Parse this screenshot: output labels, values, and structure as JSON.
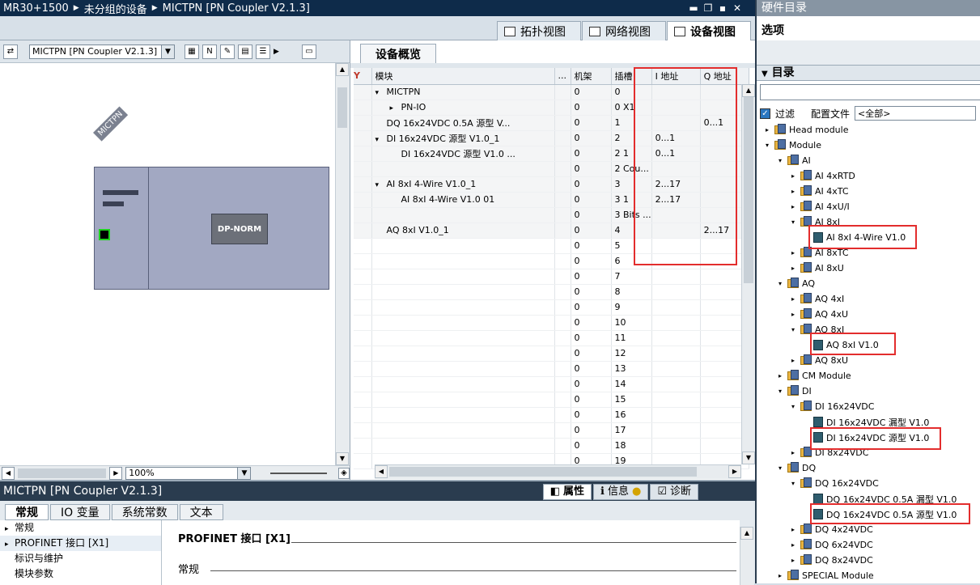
{
  "titlebar": {
    "crumb1": "MR30+1500",
    "crumb2": "未分组的设备",
    "crumb3": "MICTPN [PN Coupler V2.1.3]"
  },
  "view_tabs": {
    "topology": "拓扑视图",
    "network": "网络视图",
    "device": "设备视图"
  },
  "device_toolbar": {
    "device_select": "MICTPN [PN Coupler V2.1.3]",
    "zoom": "100%"
  },
  "canvas": {
    "device_label": "MICTPN",
    "module_label": "DP-NORM"
  },
  "overview": {
    "tab": "设备概览",
    "columns": {
      "module": "模块",
      "dots": "...",
      "rack": "机架",
      "slot": "插槽",
      "i_addr": "I 地址",
      "q_addr": "Q 地址"
    },
    "rows": [
      {
        "arrow": "▾",
        "indent": 0,
        "module": "MICTPN",
        "rack": "0",
        "slot": "0",
        "i": "",
        "q": ""
      },
      {
        "arrow": "▸",
        "indent": 1,
        "module": "PN-IO",
        "rack": "0",
        "slot": "0 X1",
        "i": "",
        "q": ""
      },
      {
        "arrow": "",
        "indent": 0,
        "module": "DQ 16x24VDC 0.5A 源型 V...",
        "rack": "0",
        "slot": "1",
        "i": "",
        "q": "0...1"
      },
      {
        "arrow": "▾",
        "indent": 0,
        "module": "DI 16x24VDC 源型 V1.0_1",
        "rack": "0",
        "slot": "2",
        "i": "0...1",
        "q": ""
      },
      {
        "arrow": "",
        "indent": 1,
        "module": "DI 16x24VDC 源型 V1.0 ...",
        "rack": "0",
        "slot": "2 1",
        "i": "0...1",
        "q": ""
      },
      {
        "arrow": "",
        "indent": 0,
        "module": "",
        "rack": "0",
        "slot": "2 Cou...",
        "i": "",
        "q": ""
      },
      {
        "arrow": "▾",
        "indent": 0,
        "module": "AI 8xI 4-Wire V1.0_1",
        "rack": "0",
        "slot": "3",
        "i": "2...17",
        "q": ""
      },
      {
        "arrow": "",
        "indent": 1,
        "module": "AI 8xI 4-Wire V1.0 01",
        "rack": "0",
        "slot": "3 1",
        "i": "2...17",
        "q": ""
      },
      {
        "arrow": "",
        "indent": 0,
        "module": "",
        "rack": "0",
        "slot": "3 Bits ...",
        "i": "",
        "q": ""
      },
      {
        "arrow": "",
        "indent": 0,
        "module": "AQ 8xI V1.0_1",
        "rack": "0",
        "slot": "4",
        "i": "",
        "q": "2...17"
      },
      {
        "arrow": "",
        "indent": 0,
        "module": "",
        "rack": "0",
        "slot": "5",
        "i": "",
        "q": ""
      },
      {
        "arrow": "",
        "indent": 0,
        "module": "",
        "rack": "0",
        "slot": "6",
        "i": "",
        "q": ""
      },
      {
        "arrow": "",
        "indent": 0,
        "module": "",
        "rack": "0",
        "slot": "7",
        "i": "",
        "q": ""
      },
      {
        "arrow": "",
        "indent": 0,
        "module": "",
        "rack": "0",
        "slot": "8",
        "i": "",
        "q": ""
      },
      {
        "arrow": "",
        "indent": 0,
        "module": "",
        "rack": "0",
        "slot": "9",
        "i": "",
        "q": ""
      },
      {
        "arrow": "",
        "indent": 0,
        "module": "",
        "rack": "0",
        "slot": "10",
        "i": "",
        "q": ""
      },
      {
        "arrow": "",
        "indent": 0,
        "module": "",
        "rack": "0",
        "slot": "11",
        "i": "",
        "q": ""
      },
      {
        "arrow": "",
        "indent": 0,
        "module": "",
        "rack": "0",
        "slot": "12",
        "i": "",
        "q": ""
      },
      {
        "arrow": "",
        "indent": 0,
        "module": "",
        "rack": "0",
        "slot": "13",
        "i": "",
        "q": ""
      },
      {
        "arrow": "",
        "indent": 0,
        "module": "",
        "rack": "0",
        "slot": "14",
        "i": "",
        "q": ""
      },
      {
        "arrow": "",
        "indent": 0,
        "module": "",
        "rack": "0",
        "slot": "15",
        "i": "",
        "q": ""
      },
      {
        "arrow": "",
        "indent": 0,
        "module": "",
        "rack": "0",
        "slot": "16",
        "i": "",
        "q": ""
      },
      {
        "arrow": "",
        "indent": 0,
        "module": "",
        "rack": "0",
        "slot": "17",
        "i": "",
        "q": ""
      },
      {
        "arrow": "",
        "indent": 0,
        "module": "",
        "rack": "0",
        "slot": "18",
        "i": "",
        "q": ""
      },
      {
        "arrow": "",
        "indent": 0,
        "module": "",
        "rack": "0",
        "slot": "19",
        "i": "",
        "q": ""
      }
    ]
  },
  "bottom": {
    "title": "MICTPN [PN Coupler V2.1.3]",
    "prop_tabs": {
      "properties": "属性",
      "info": "信息",
      "diagnostics": "诊断"
    },
    "sub_tabs": [
      "常规",
      "IO 变量",
      "系统常数",
      "文本"
    ],
    "nav": [
      "常规",
      "PROFINET 接口 [X1]",
      "标识与维护",
      "模块参数"
    ],
    "section_title": "PROFINET 接口 [X1]",
    "section_sub": "常规"
  },
  "catalog": {
    "title": "硬件目录",
    "options": "选项",
    "catalog_header": "目录",
    "filter_label": "过滤",
    "profile_label": "配置文件",
    "profile_value": "<全部>",
    "tree": [
      {
        "level": 0,
        "arrow": "▸",
        "icon": "folder",
        "label": "Head module"
      },
      {
        "level": 0,
        "arrow": "▾",
        "icon": "folder",
        "label": "Module"
      },
      {
        "level": 1,
        "arrow": "▾",
        "icon": "folder",
        "label": "AI"
      },
      {
        "level": 2,
        "arrow": "▸",
        "icon": "folder",
        "label": "AI 4xRTD"
      },
      {
        "level": 2,
        "arrow": "▸",
        "icon": "folder",
        "label": "AI 4xTC"
      },
      {
        "level": 2,
        "arrow": "▸",
        "icon": "folder",
        "label": "AI 4xU/I"
      },
      {
        "level": 2,
        "arrow": "▾",
        "icon": "folder",
        "label": "AI 8xI"
      },
      {
        "level": 3,
        "arrow": "",
        "icon": "module",
        "label": "AI 8xI 4-Wire V1.0"
      },
      {
        "level": 2,
        "arrow": "▸",
        "icon": "folder",
        "label": "AI 8xTC"
      },
      {
        "level": 2,
        "arrow": "▸",
        "icon": "folder",
        "label": "AI 8xU"
      },
      {
        "level": 1,
        "arrow": "▾",
        "icon": "folder",
        "label": "AQ"
      },
      {
        "level": 2,
        "arrow": "▸",
        "icon": "folder",
        "label": "AQ 4xI"
      },
      {
        "level": 2,
        "arrow": "▸",
        "icon": "folder",
        "label": "AQ 4xU"
      },
      {
        "level": 2,
        "arrow": "▾",
        "icon": "folder",
        "label": "AQ 8xI"
      },
      {
        "level": 3,
        "arrow": "",
        "icon": "module",
        "label": "AQ 8xI V1.0"
      },
      {
        "level": 2,
        "arrow": "▸",
        "icon": "folder",
        "label": "AQ 8xU"
      },
      {
        "level": 1,
        "arrow": "▸",
        "icon": "folder",
        "label": "CM Module"
      },
      {
        "level": 1,
        "arrow": "▾",
        "icon": "folder",
        "label": "DI"
      },
      {
        "level": 2,
        "arrow": "▾",
        "icon": "folder",
        "label": "DI 16x24VDC"
      },
      {
        "level": 3,
        "arrow": "",
        "icon": "module",
        "label": "DI 16x24VDC 漏型 V1.0"
      },
      {
        "level": 3,
        "arrow": "",
        "icon": "module",
        "label": "DI 16x24VDC 源型 V1.0"
      },
      {
        "level": 2,
        "arrow": "▸",
        "icon": "folder",
        "label": "DI 8x24VDC"
      },
      {
        "level": 1,
        "arrow": "▾",
        "icon": "folder",
        "label": "DQ"
      },
      {
        "level": 2,
        "arrow": "▾",
        "icon": "folder",
        "label": "DQ 16x24VDC"
      },
      {
        "level": 3,
        "arrow": "",
        "icon": "module",
        "label": "DQ 16x24VDC 0.5A 漏型 V1.0"
      },
      {
        "level": 3,
        "arrow": "",
        "icon": "module",
        "label": "DQ 16x24VDC 0.5A 源型 V1.0"
      },
      {
        "level": 2,
        "arrow": "▸",
        "icon": "folder",
        "label": "DQ 4x24VDC"
      },
      {
        "level": 2,
        "arrow": "▸",
        "icon": "folder",
        "label": "DQ 6x24VDC"
      },
      {
        "level": 2,
        "arrow": "▸",
        "icon": "folder",
        "label": "DQ 8x24VDC"
      },
      {
        "level": 1,
        "arrow": "▸",
        "icon": "folder",
        "label": "SPECIAL Module"
      }
    ]
  },
  "colors": {
    "highlight_red": "#e32d2d",
    "title_bar": "#0e2b4a"
  }
}
